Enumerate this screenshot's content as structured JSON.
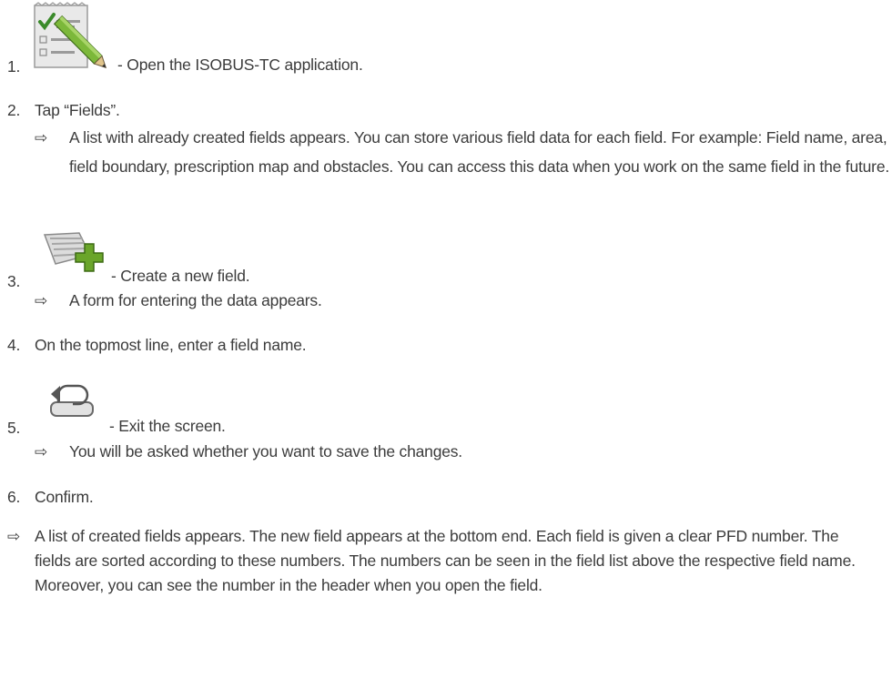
{
  "steps": [
    {
      "number": "1.",
      "icon": "task-list-pencil-icon",
      "text": "- Open the ISOBUS-TC application."
    },
    {
      "number": "2.",
      "text": "Tap “Fields”.",
      "result": "A list with already created fields appears. You can store various field data for each field. For example: Field name, area, field boundary, prescription map and obstacles. You can access this data when you work on the same field in the future."
    },
    {
      "number": "3.",
      "icon": "field-add-icon",
      "text": "- Create a new field.",
      "result": "A form for entering the data appears."
    },
    {
      "number": "4.",
      "text": "On the topmost line, enter a field name."
    },
    {
      "number": "5.",
      "icon": "return-arrow-icon",
      "text": "- Exit the screen.",
      "result": "You will be asked whether you want to save the changes."
    },
    {
      "number": "6.",
      "text": "Confirm."
    }
  ],
  "result_arrow": "⇨",
  "final_result": "A list of created fields appears. The new field appears at the bottom end. Each field is given a clear PFD number. The fields are sorted according to these numbers. The numbers can be seen in the field list above the respective field name. Moreover, you can see the number in the header when you open the field.",
  "colors": {
    "text": "#3c3c3c",
    "icon_green": "#6aa52a",
    "icon_gray": "#b8b8b8"
  }
}
